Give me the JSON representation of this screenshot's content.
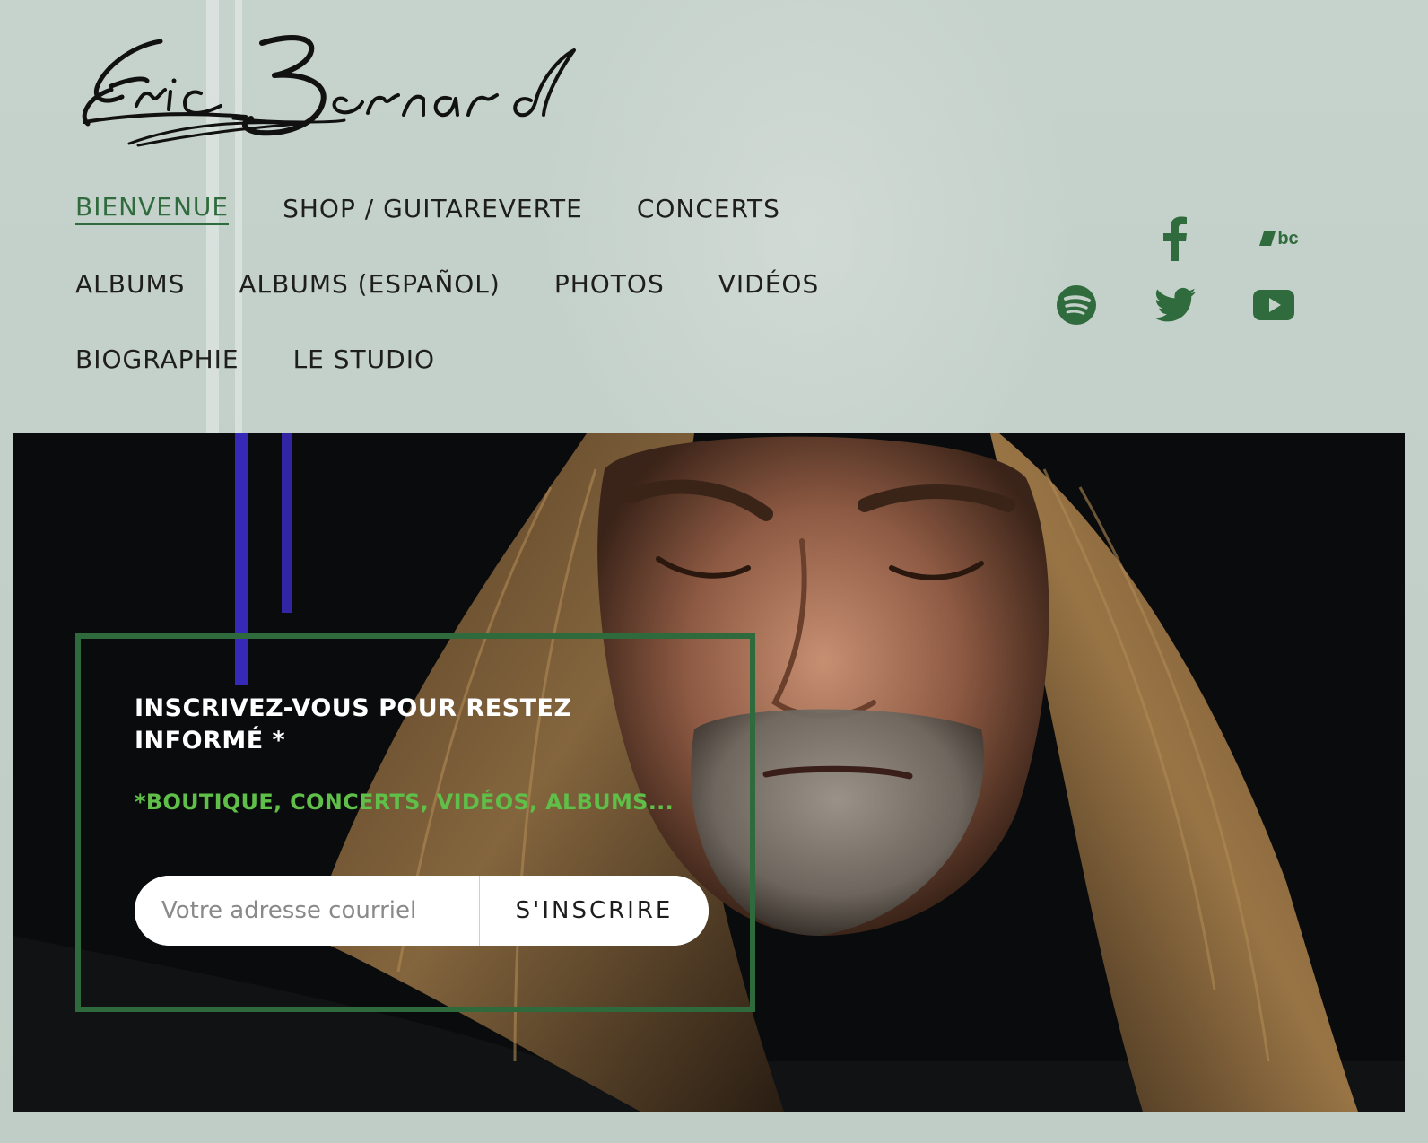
{
  "header": {
    "logo_text": "Eric Bernard",
    "nav": [
      {
        "label": "BIENVENUE",
        "active": true
      },
      {
        "label": "SHOP / GUITAREVERTE"
      },
      {
        "label": "CONCERTS"
      },
      {
        "label": "ALBUMS"
      },
      {
        "label": "ALBUMS (ESPAÑOL)"
      },
      {
        "label": "PHOTOS"
      },
      {
        "label": "VIDÉOS"
      },
      {
        "label": "BIOGRAPHIE"
      },
      {
        "label": "LE STUDIO"
      }
    ],
    "social": {
      "icons": [
        "facebook-icon",
        "bandcamp-icon",
        "spotify-icon",
        "twitter-icon",
        "youtube-icon"
      ],
      "bandcamp_label": "bc"
    }
  },
  "signup": {
    "title": "INSCRIVEZ-VOUS POUR RESTEZ INFORMÉ *",
    "subtitle": "*BOUTIQUE, CONCERTS, VIDÉOS, ALBUMS...",
    "email_placeholder": "Votre adresse courriel",
    "submit_label": "S'INSCRIRE"
  },
  "colors": {
    "accent_green": "#2f6b3c",
    "subtitle_green": "#5fbf49",
    "header_bg": "#c3d0c9",
    "hero_bg": "#0b0c0d"
  }
}
